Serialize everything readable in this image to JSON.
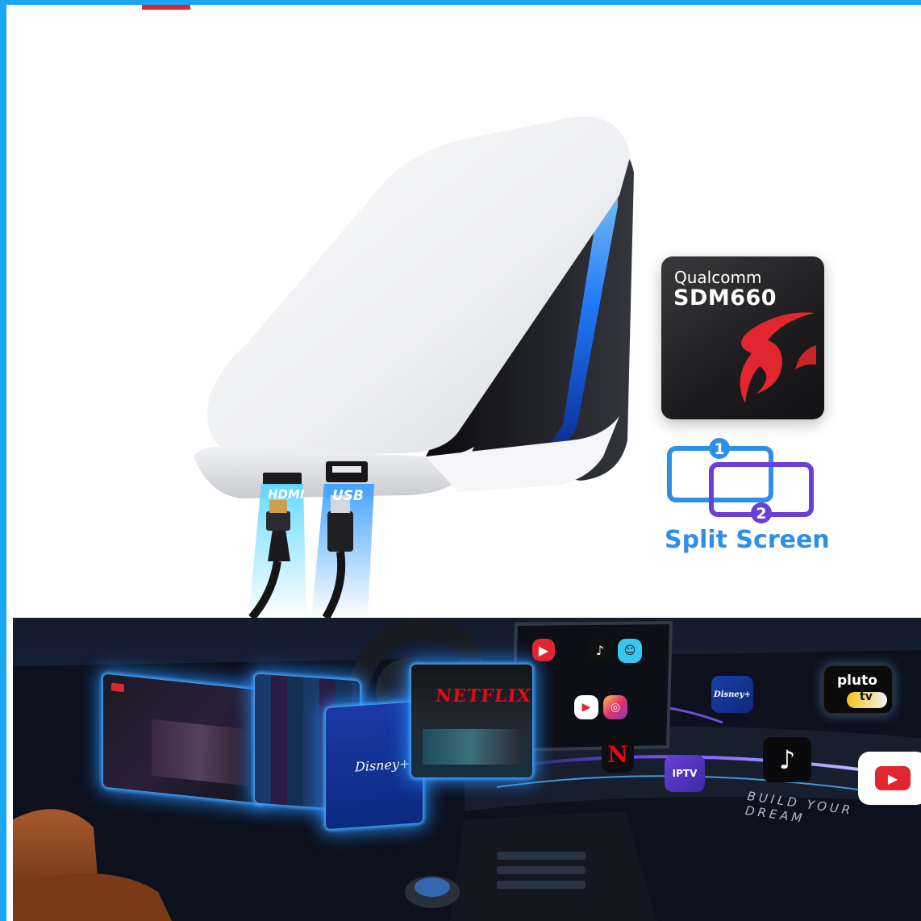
{
  "ports": {
    "hdmi_label": "HDMI",
    "usb_label": "USB"
  },
  "chip": {
    "brand": "Qualcomm",
    "model": "SDM660"
  },
  "split_screen": {
    "label": "Split Screen",
    "pane_1": "1",
    "pane_2": "2"
  },
  "apps": {
    "netflix": "NETFLIX",
    "disney": "Disney+",
    "pluto": "pluto",
    "pluto_tv": "tv",
    "iptv": "IPTV"
  },
  "slogan": "BUILD YOUR DREAM",
  "colors": {
    "accent_blue": "#2f8fe8",
    "frame_blue": "#1aa6f0",
    "split_purple": "#6a3fd8",
    "qualcomm_red": "#e0262f",
    "netflix_red": "#e50914",
    "glow_blue": "#2b8cff"
  }
}
